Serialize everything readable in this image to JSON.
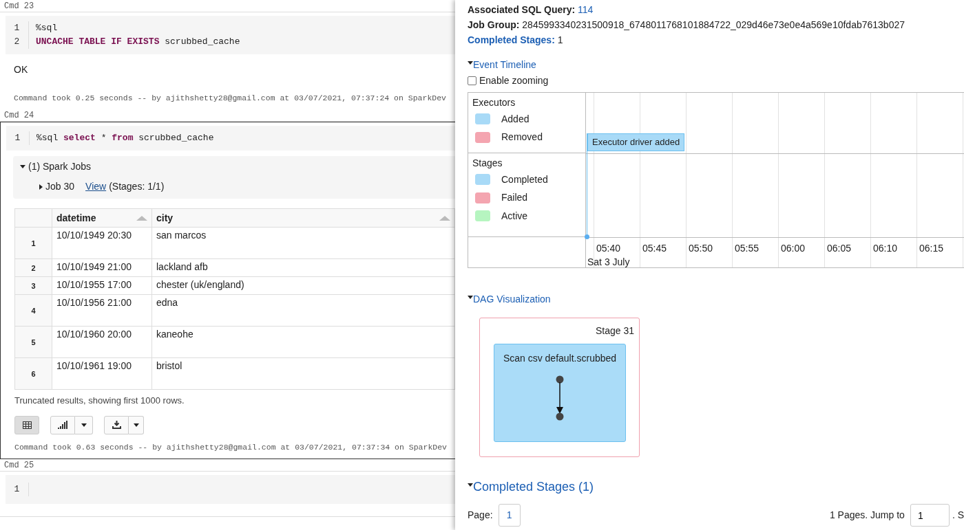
{
  "notebook": {
    "cells": [
      {
        "label": "Cmd 23",
        "focused": false,
        "lines": [
          {
            "number": "1",
            "tokens": [
              {
                "kind": "plain",
                "text": "%sql"
              }
            ]
          },
          {
            "number": "2",
            "tokens": [
              {
                "kind": "keyword",
                "text": "UNCACHE TABLE IF EXISTS"
              },
              {
                "kind": "plain",
                "text": " scrubbed_cache"
              }
            ]
          }
        ],
        "output": {
          "text": "OK"
        },
        "footer": "Command took 0.25 seconds -- by ajithshetty28@gmail.com at 03/07/2021, 07:37:24 on SparkDev"
      },
      {
        "label": "Cmd 24",
        "focused": true,
        "lines": [
          {
            "number": "1",
            "tokens": [
              {
                "kind": "plain",
                "text": "%sql "
              },
              {
                "kind": "keyword",
                "text": "select"
              },
              {
                "kind": "plain",
                "text": " * "
              },
              {
                "kind": "keyword",
                "text": "from"
              },
              {
                "kind": "plain",
                "text": " scrubbed_cache"
              }
            ]
          }
        ],
        "spark_jobs": {
          "title": "(1) Spark Jobs",
          "expanded": true,
          "jobs": [
            {
              "name": "Job 30",
              "expanded": false,
              "link": "View",
              "stages": "(Stages: 1/1)"
            }
          ]
        },
        "table": {
          "columns": [
            "datetime",
            "city"
          ],
          "rows": [
            {
              "index": "1",
              "cells": [
                "10/10/1949 20:30",
                "san marcos"
              ],
              "tall": true
            },
            {
              "index": "2",
              "cells": [
                "10/10/1949 21:00",
                "lackland afb"
              ],
              "tall": false
            },
            {
              "index": "3",
              "cells": [
                "10/10/1955 17:00",
                "chester (uk/england)"
              ],
              "tall": false
            },
            {
              "index": "4",
              "cells": [
                "10/10/1956 21:00",
                "edna"
              ],
              "tall": true
            },
            {
              "index": "5",
              "cells": [
                "10/10/1960 20:00",
                "kaneohe"
              ],
              "tall": true
            },
            {
              "index": "6",
              "cells": [
                "10/10/1961 19:00",
                "bristol"
              ],
              "tall": true
            }
          ]
        },
        "note": "Truncated results, showing first 1000 rows.",
        "view_buttons": [
          {
            "kind": "table",
            "selected": true
          },
          {
            "kind": "chart",
            "selected": false
          }
        ],
        "footer": "Command took 0.63 seconds -- by ajithshetty28@gmail.com at 03/07/2021, 07:37:34 on SparkDev"
      },
      {
        "label": "Cmd 25",
        "focused": false,
        "lines": [
          {
            "number": "1"
          }
        ]
      }
    ]
  },
  "job_details": {
    "summary": [
      {
        "label": "Associated SQL Query:",
        "value": "114",
        "kind": "link"
      },
      {
        "label": "Job Group:",
        "value": "2845993340231500918_6748011768101884722_029d46e73e0e4a569e10fdab7613b027",
        "kind": "plain"
      },
      {
        "label": "Completed Stages:",
        "value": "1",
        "kind": "linklabel"
      }
    ],
    "event_timeline": {
      "title": "Event Timeline",
      "expanded": true,
      "zoom_label": "Enable zooming",
      "zoom_checked": false,
      "groups": [
        {
          "title": "Executors",
          "legend": [
            {
              "label": "Added",
              "color": "#a8daf7"
            },
            {
              "label": "Removed",
              "color": "#f4a5b0"
            }
          ]
        },
        {
          "title": "Stages",
          "legend": [
            {
              "label": "Completed",
              "color": "#a8daf7"
            },
            {
              "label": "Failed",
              "color": "#f4a5b0"
            },
            {
              "label": "Active",
              "color": "#b6f5c0"
            }
          ]
        }
      ],
      "event": "Executor driver added",
      "ticks": [
        "05:40",
        "05:45",
        "05:50",
        "05:55",
        "06:00",
        "06:05",
        "06:10",
        "06:15"
      ],
      "date": "Sat 3 July"
    },
    "dag": {
      "title": "DAG Visualization",
      "expanded": true,
      "stage": "Stage 31",
      "node": "Scan csv default.scrubbed"
    },
    "completed_stages": {
      "title": "Completed Stages (1)",
      "expanded": true,
      "page_label": "Page:",
      "pages": [
        {
          "label": "1",
          "selected": true
        }
      ],
      "pages_text": "1 Pages. Jump to",
      "jump_value": "1",
      "trailing": ". S"
    }
  }
}
